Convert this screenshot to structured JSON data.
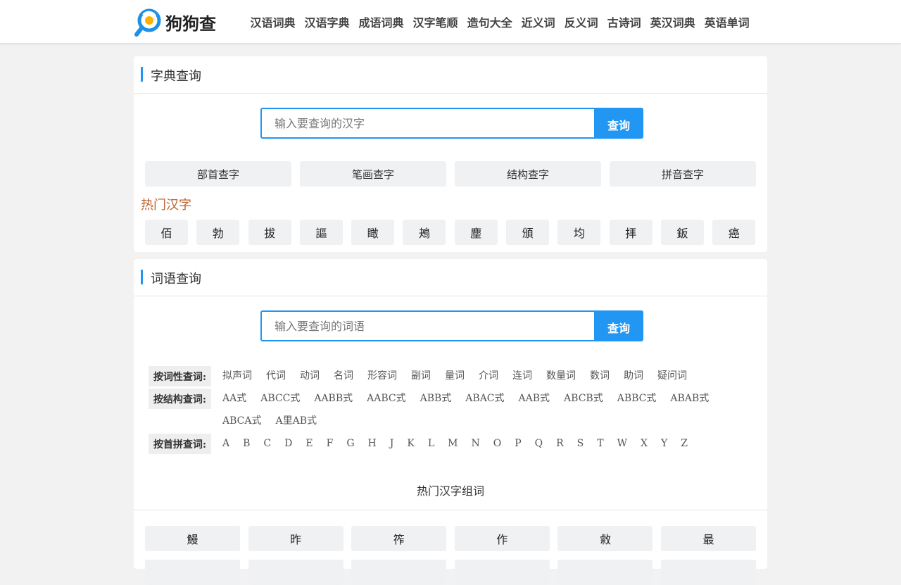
{
  "header": {
    "logo_text": "狗狗查",
    "nav": [
      "汉语词典",
      "汉语字典",
      "成语词典",
      "汉字笔顺",
      "造句大全",
      "近义词",
      "反义词",
      "古诗词",
      "英汉词典",
      "英语单词"
    ]
  },
  "zidian": {
    "title": "字典查询",
    "placeholder": "输入要查询的汉字",
    "button": "查询",
    "modes": [
      "部首查字",
      "笔画查字",
      "结构查字",
      "拼音查字"
    ],
    "hot_title": "热门汉字",
    "hot_chars": [
      "佰",
      "勃",
      "拔",
      "謳",
      "瞰",
      "鴂",
      "麈",
      "頒",
      "均",
      "拝",
      "鈑",
      "癌"
    ]
  },
  "cidian": {
    "title": "词语查询",
    "placeholder": "输入要查询的词语",
    "button": "查询",
    "filters": {
      "pos": {
        "label": "按词性查词:",
        "items": [
          "拟声词",
          "代词",
          "动词",
          "名词",
          "形容词",
          "副词",
          "量词",
          "介词",
          "连词",
          "数量词",
          "数词",
          "助词",
          "疑问词"
        ]
      },
      "structure": {
        "label": "按结构查词:",
        "items": [
          "AA式",
          "ABCC式",
          "AABB式",
          "AABC式",
          "ABB式",
          "ABAC式",
          "AAB式",
          "ABCB式",
          "ABBC式",
          "ABAB式",
          "ABCA式",
          "A里AB式"
        ]
      },
      "pinyin": {
        "label": "按首拼查词:",
        "items": [
          "A",
          "B",
          "C",
          "D",
          "E",
          "F",
          "G",
          "H",
          "J",
          "K",
          "L",
          "M",
          "N",
          "O",
          "P",
          "Q",
          "R",
          "S",
          "T",
          "W",
          "X",
          "Y",
          "Z"
        ]
      }
    },
    "combo_title": "热门汉字组词",
    "combo_chars": [
      "鰻",
      "昨",
      "筰",
      "作",
      "敹",
      "最"
    ]
  },
  "colors": {
    "accent": "#2196f3",
    "hot_title": "#c0602b",
    "background": "#f2f2f2"
  },
  "icons": {
    "logo": "magnifier-logo-icon"
  }
}
